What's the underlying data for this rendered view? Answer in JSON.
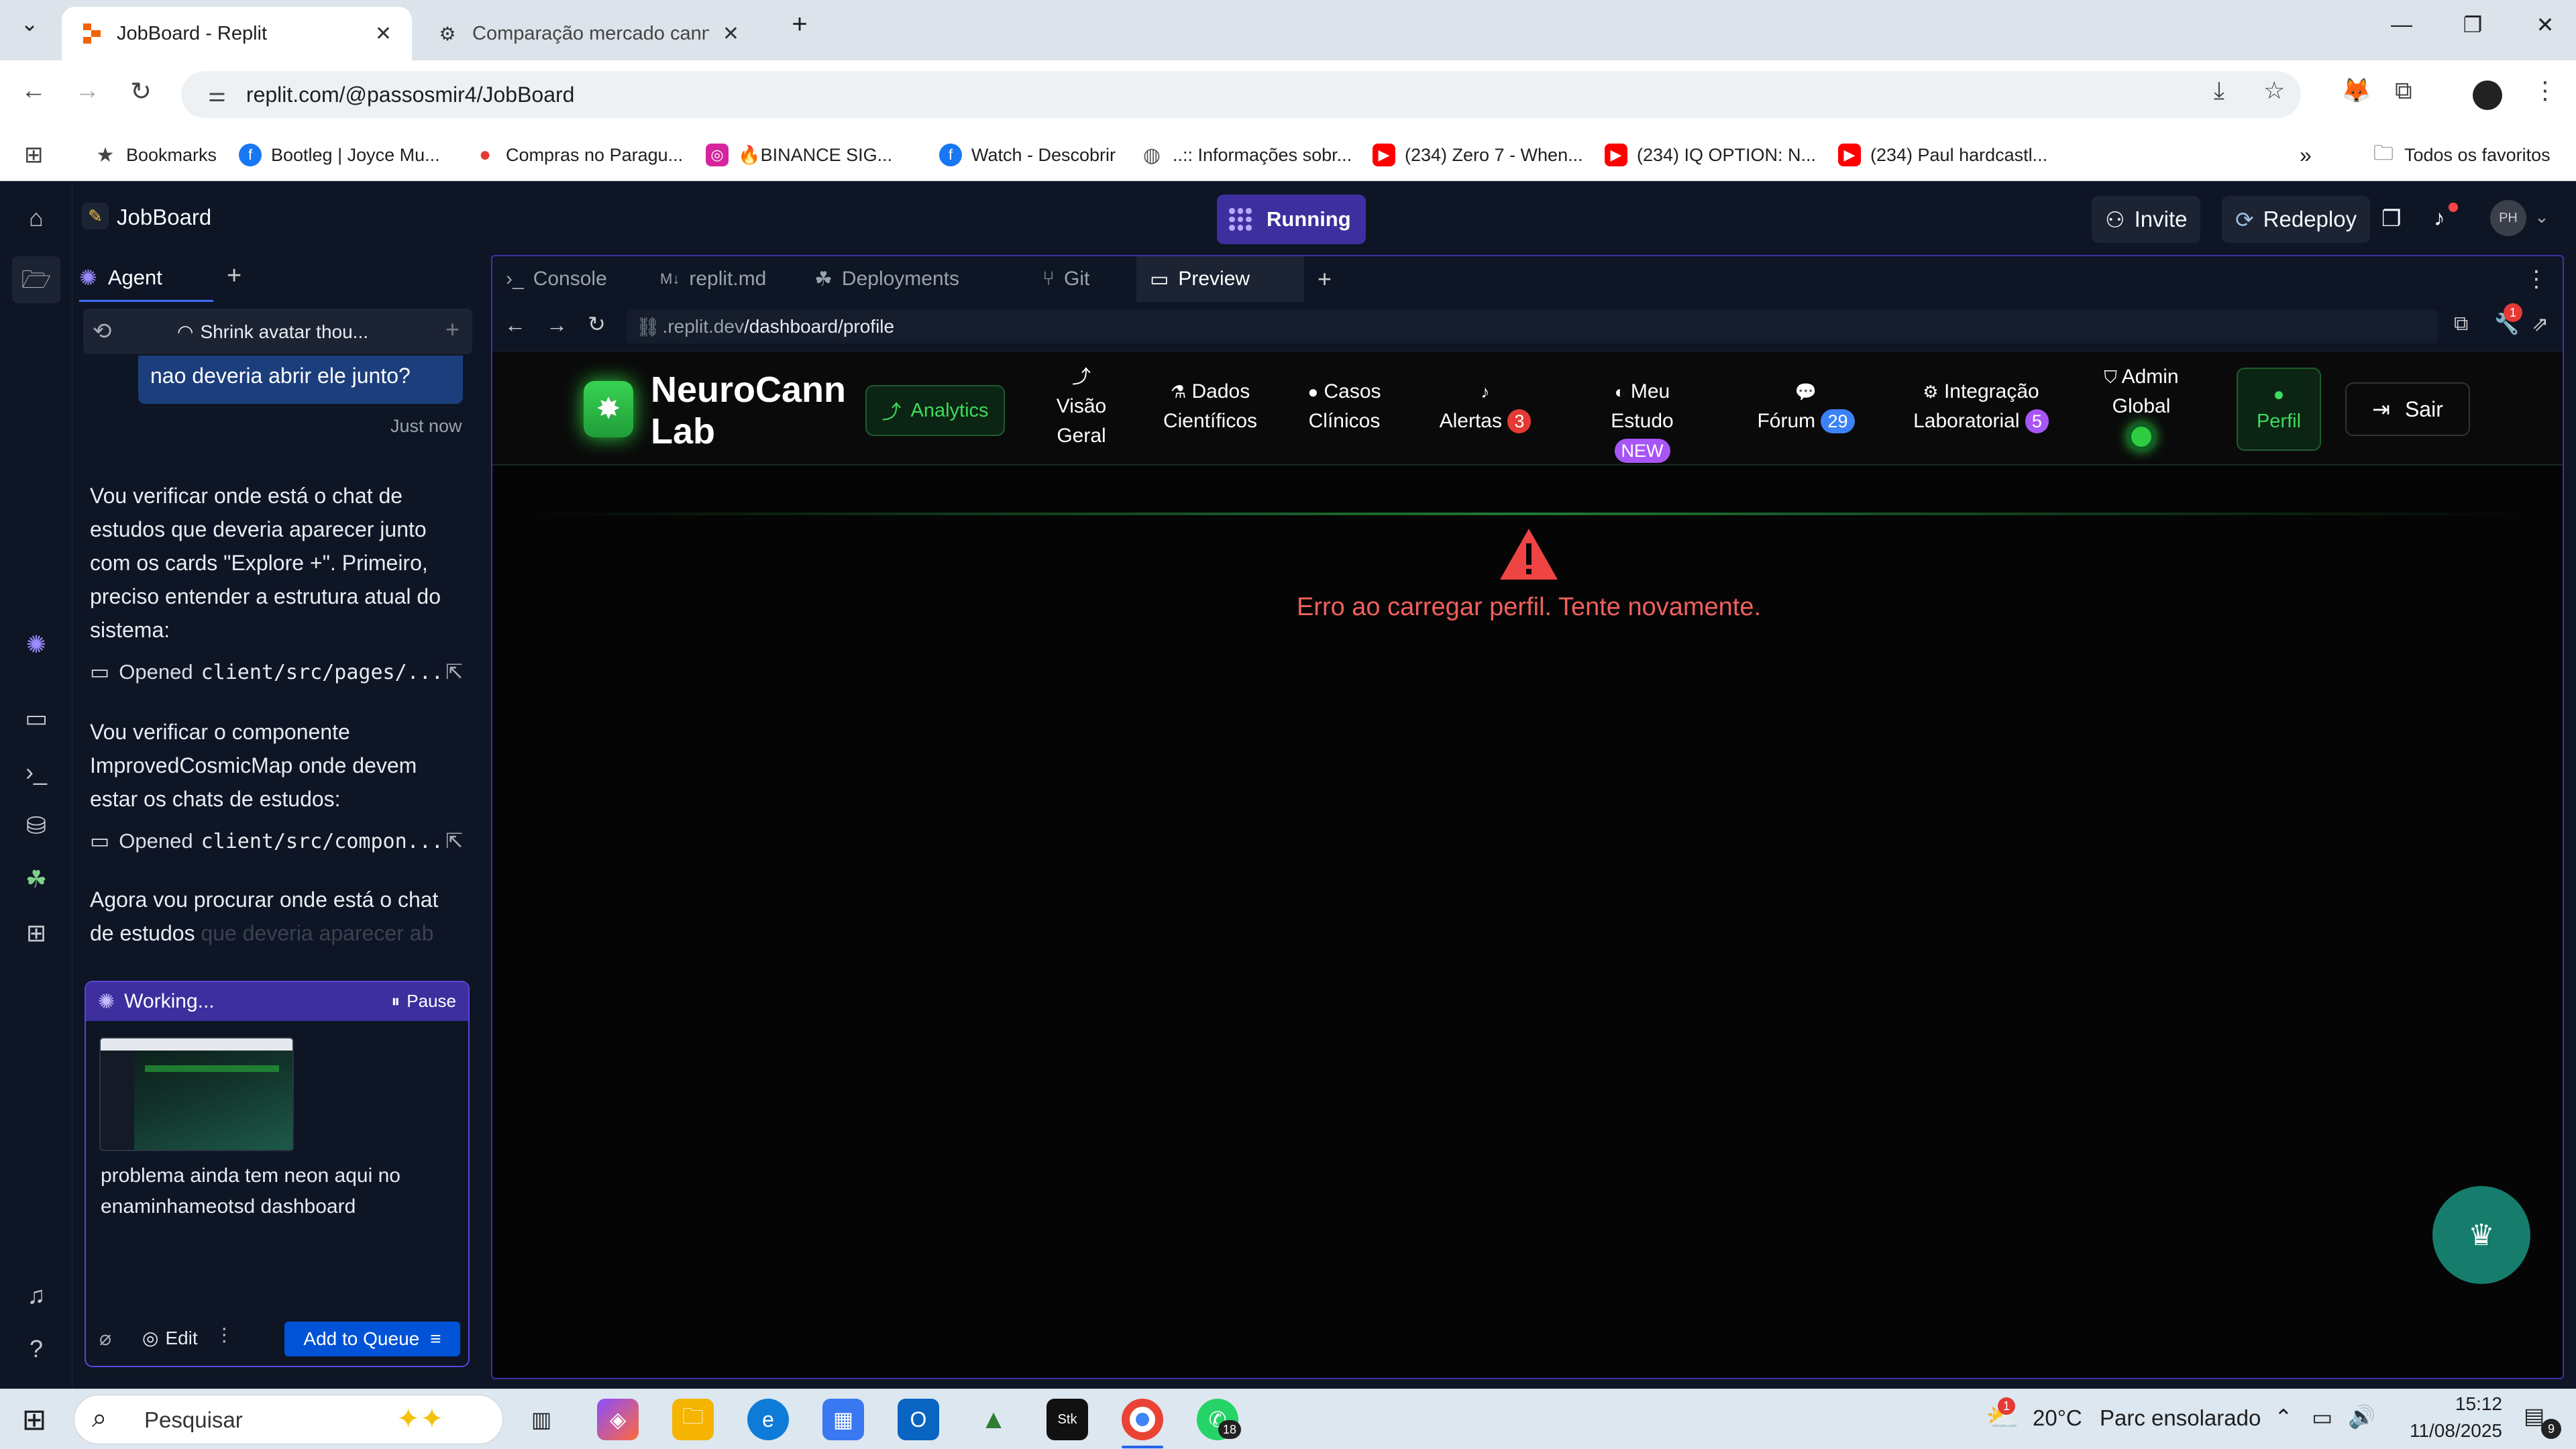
{
  "browser": {
    "tabs": [
      {
        "title": "JobBoard - Replit"
      },
      {
        "title": "Comparação mercado cannabis"
      }
    ],
    "url": "replit.com/@passosmir4/JobBoard",
    "bookmarks": [
      {
        "label": "Bookmarks",
        "icon": "star-icon"
      },
      {
        "label": "Bootleg | Joyce Mu...",
        "icon": "facebook-icon"
      },
      {
        "label": "Compras no Paragu...",
        "icon": "map-pin-icon"
      },
      {
        "label": "🔥BINANCE SIG...",
        "icon": "instagram-icon"
      },
      {
        "label": "Watch - Descobrir",
        "icon": "facebook-icon"
      },
      {
        "label": "..:: Informações sobr...",
        "icon": "globe-icon"
      },
      {
        "label": "(234) Zero 7 - When...",
        "icon": "youtube-icon"
      },
      {
        "label": "(234) IQ OPTION: N...",
        "icon": "youtube-icon"
      },
      {
        "label": "(234) Paul hardcastl...",
        "icon": "youtube-icon"
      }
    ],
    "all_bookmarks_label": "Todos os favoritos"
  },
  "replit": {
    "repl_name": "JobBoard",
    "status_label": "Running",
    "invite_label": "Invite",
    "redeploy_label": "Redeploy",
    "avatar_initials": "PH",
    "agent": {
      "tab_label": "Agent",
      "thread_title": "Shrink avatar thou...",
      "user_message": "nao deveria abrir ele junto?",
      "user_time": "Just now",
      "messages": [
        "Vou verificar onde está o chat de estudos que deveria aparecer junto com os cards \"Explore +\". Primeiro, preciso entender a estrutura atual do sistema:",
        "Vou verificar o componente ImprovedCosmicMap onde devem estar os chats de estudos:",
        "Agora vou procurar onde está o chat de estudos",
        "que deveria aparecer ab"
      ],
      "opened_label": "Opened",
      "opened_files": [
        "client/src/pages/...",
        "client/src/compon..."
      ],
      "working_label": "Working...",
      "pause_label": "Pause",
      "draft_text": "problema ainda tem neon aqui no enaminhameotsd dashboard",
      "edit_label": "Edit",
      "queue_label": "Add to Queue"
    },
    "pane_tabs": [
      "Console",
      "replit.md",
      "Deployments",
      "Git",
      "Preview"
    ],
    "preview": {
      "url_host": ".replit.dev",
      "url_path": "/dashboard/profile",
      "notifications_count": "1",
      "app": {
        "brand_line1": "NeuroCann",
        "brand_line2": "Lab",
        "nav": {
          "analytics": "Analytics",
          "visao_1": "Visão",
          "visao_2": "Geral",
          "dados_1": "Dados",
          "dados_2": "Científicos",
          "casos_1": "Casos",
          "casos_2": "Clínicos",
          "alertas": "Alertas",
          "alertas_count": "3",
          "estudo_1": "Meu",
          "estudo_2": "Estudo",
          "estudo_badge": "NEW",
          "forum": "Fórum",
          "forum_count": "29",
          "integ_1": "Integração",
          "integ_2": "Laboratorial",
          "integ_count": "5",
          "admin_1": "Admin",
          "admin_2": "Global",
          "perfil": "Perfil",
          "sair": "Sair"
        },
        "error_message": "Erro ao carregar perfil. Tente novamente."
      }
    }
  },
  "taskbar": {
    "search_placeholder": "Pesquisar",
    "whatsapp_badge": "18",
    "weather": "20°C",
    "weather_desc": "Parc ensolarado",
    "weather_alert": "1",
    "time": "15:12",
    "date": "11/08/2025",
    "notifications": "9"
  },
  "colors": {
    "replit_bg": "#0e1525",
    "accent_purple": "#3d2f9e",
    "error_red": "#f0605d",
    "neon_green": "#2ecc40"
  }
}
